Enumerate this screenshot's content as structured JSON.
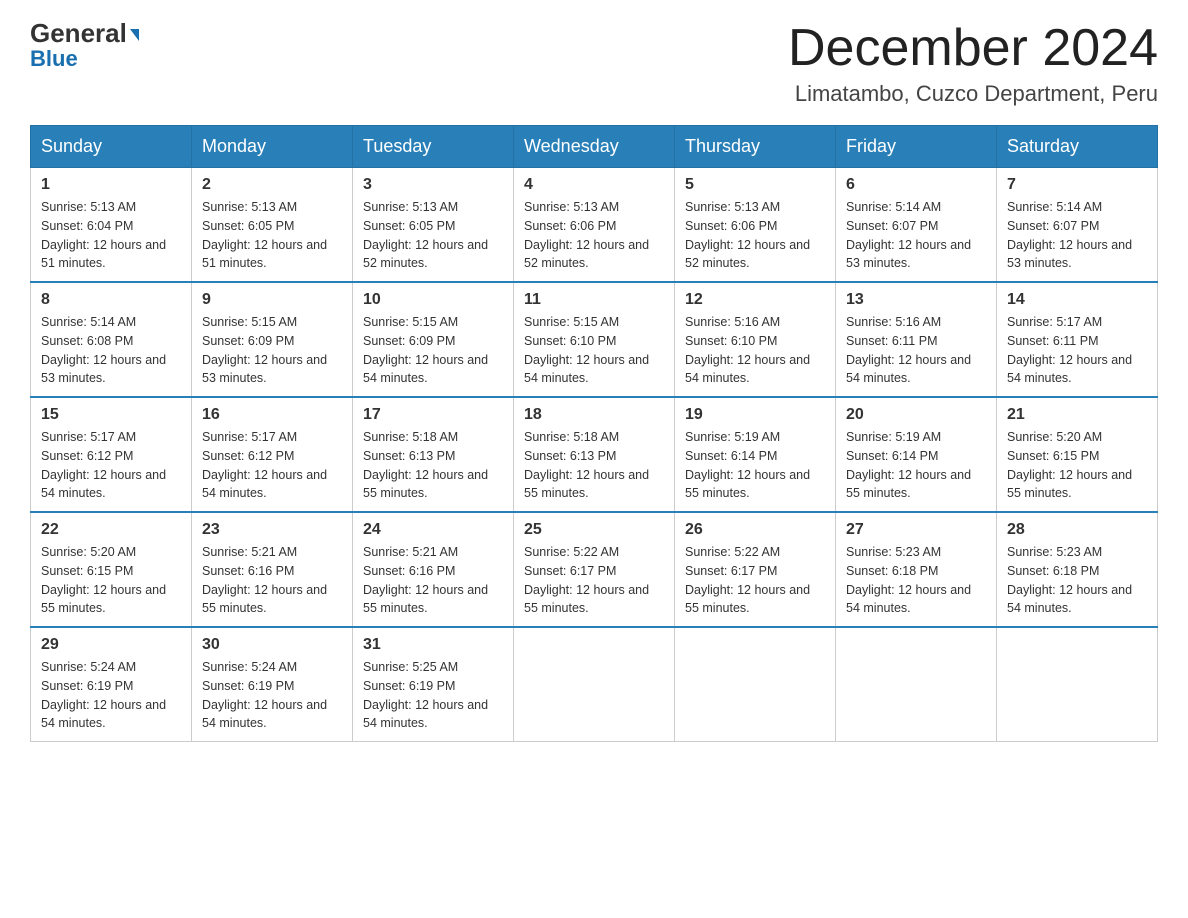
{
  "header": {
    "logo_text": "General",
    "logo_blue": "Blue",
    "month_title": "December 2024",
    "location": "Limatambo, Cuzco Department, Peru"
  },
  "days_of_week": [
    "Sunday",
    "Monday",
    "Tuesday",
    "Wednesday",
    "Thursday",
    "Friday",
    "Saturday"
  ],
  "weeks": [
    [
      {
        "day": "1",
        "sunrise": "5:13 AM",
        "sunset": "6:04 PM",
        "daylight": "12 hours and 51 minutes."
      },
      {
        "day": "2",
        "sunrise": "5:13 AM",
        "sunset": "6:05 PM",
        "daylight": "12 hours and 51 minutes."
      },
      {
        "day": "3",
        "sunrise": "5:13 AM",
        "sunset": "6:05 PM",
        "daylight": "12 hours and 52 minutes."
      },
      {
        "day": "4",
        "sunrise": "5:13 AM",
        "sunset": "6:06 PM",
        "daylight": "12 hours and 52 minutes."
      },
      {
        "day": "5",
        "sunrise": "5:13 AM",
        "sunset": "6:06 PM",
        "daylight": "12 hours and 52 minutes."
      },
      {
        "day": "6",
        "sunrise": "5:14 AM",
        "sunset": "6:07 PM",
        "daylight": "12 hours and 53 minutes."
      },
      {
        "day": "7",
        "sunrise": "5:14 AM",
        "sunset": "6:07 PM",
        "daylight": "12 hours and 53 minutes."
      }
    ],
    [
      {
        "day": "8",
        "sunrise": "5:14 AM",
        "sunset": "6:08 PM",
        "daylight": "12 hours and 53 minutes."
      },
      {
        "day": "9",
        "sunrise": "5:15 AM",
        "sunset": "6:09 PM",
        "daylight": "12 hours and 53 minutes."
      },
      {
        "day": "10",
        "sunrise": "5:15 AM",
        "sunset": "6:09 PM",
        "daylight": "12 hours and 54 minutes."
      },
      {
        "day": "11",
        "sunrise": "5:15 AM",
        "sunset": "6:10 PM",
        "daylight": "12 hours and 54 minutes."
      },
      {
        "day": "12",
        "sunrise": "5:16 AM",
        "sunset": "6:10 PM",
        "daylight": "12 hours and 54 minutes."
      },
      {
        "day": "13",
        "sunrise": "5:16 AM",
        "sunset": "6:11 PM",
        "daylight": "12 hours and 54 minutes."
      },
      {
        "day": "14",
        "sunrise": "5:17 AM",
        "sunset": "6:11 PM",
        "daylight": "12 hours and 54 minutes."
      }
    ],
    [
      {
        "day": "15",
        "sunrise": "5:17 AM",
        "sunset": "6:12 PM",
        "daylight": "12 hours and 54 minutes."
      },
      {
        "day": "16",
        "sunrise": "5:17 AM",
        "sunset": "6:12 PM",
        "daylight": "12 hours and 54 minutes."
      },
      {
        "day": "17",
        "sunrise": "5:18 AM",
        "sunset": "6:13 PM",
        "daylight": "12 hours and 55 minutes."
      },
      {
        "day": "18",
        "sunrise": "5:18 AM",
        "sunset": "6:13 PM",
        "daylight": "12 hours and 55 minutes."
      },
      {
        "day": "19",
        "sunrise": "5:19 AM",
        "sunset": "6:14 PM",
        "daylight": "12 hours and 55 minutes."
      },
      {
        "day": "20",
        "sunrise": "5:19 AM",
        "sunset": "6:14 PM",
        "daylight": "12 hours and 55 minutes."
      },
      {
        "day": "21",
        "sunrise": "5:20 AM",
        "sunset": "6:15 PM",
        "daylight": "12 hours and 55 minutes."
      }
    ],
    [
      {
        "day": "22",
        "sunrise": "5:20 AM",
        "sunset": "6:15 PM",
        "daylight": "12 hours and 55 minutes."
      },
      {
        "day": "23",
        "sunrise": "5:21 AM",
        "sunset": "6:16 PM",
        "daylight": "12 hours and 55 minutes."
      },
      {
        "day": "24",
        "sunrise": "5:21 AM",
        "sunset": "6:16 PM",
        "daylight": "12 hours and 55 minutes."
      },
      {
        "day": "25",
        "sunrise": "5:22 AM",
        "sunset": "6:17 PM",
        "daylight": "12 hours and 55 minutes."
      },
      {
        "day": "26",
        "sunrise": "5:22 AM",
        "sunset": "6:17 PM",
        "daylight": "12 hours and 55 minutes."
      },
      {
        "day": "27",
        "sunrise": "5:23 AM",
        "sunset": "6:18 PM",
        "daylight": "12 hours and 54 minutes."
      },
      {
        "day": "28",
        "sunrise": "5:23 AM",
        "sunset": "6:18 PM",
        "daylight": "12 hours and 54 minutes."
      }
    ],
    [
      {
        "day": "29",
        "sunrise": "5:24 AM",
        "sunset": "6:19 PM",
        "daylight": "12 hours and 54 minutes."
      },
      {
        "day": "30",
        "sunrise": "5:24 AM",
        "sunset": "6:19 PM",
        "daylight": "12 hours and 54 minutes."
      },
      {
        "day": "31",
        "sunrise": "5:25 AM",
        "sunset": "6:19 PM",
        "daylight": "12 hours and 54 minutes."
      },
      null,
      null,
      null,
      null
    ]
  ]
}
